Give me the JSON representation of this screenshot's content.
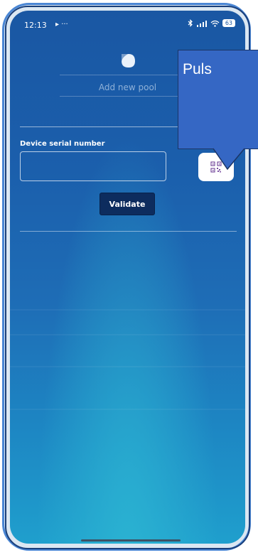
{
  "status_bar": {
    "time": "12:13",
    "extra": "▸ ···",
    "battery": "63"
  },
  "header": {
    "title": "Add new pool"
  },
  "form": {
    "serial_label": "Device serial number",
    "serial_value": "",
    "qr_button_icon": "qr-code-icon",
    "validate_label": "Validate"
  },
  "tooltip": {
    "text": "Puls"
  },
  "colors": {
    "accent": "#0d2c5e",
    "frame": "#4a86d4",
    "tooltip": "#3567c4",
    "qr_icon": "#7a4fa0"
  }
}
